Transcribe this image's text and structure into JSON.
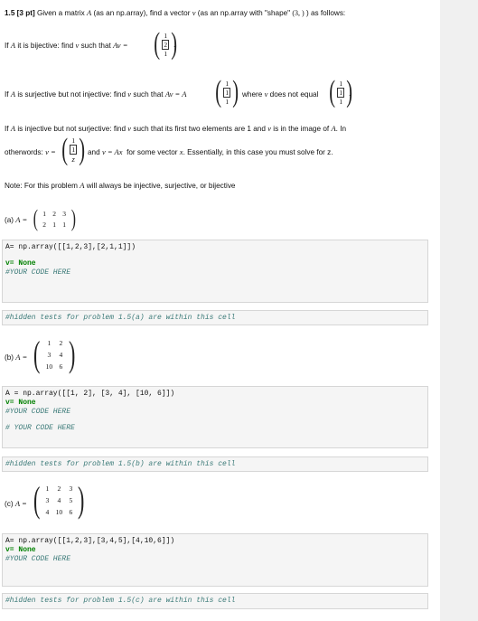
{
  "intro": {
    "label": "1.5 [3 pt]",
    "text_a": "Given a matrix",
    "text_b": "(as an np.array), find a vector",
    "text_c": "(as an np.array with \"shape\"",
    "shape": "(3, )",
    "text_d": ") as follows:"
  },
  "symbols": {
    "A": "A",
    "v": "v",
    "x": "x",
    "z": "z",
    "eq": "="
  },
  "case1": {
    "text_a": "If",
    "text_b": "it is bijective: find",
    "text_c": "such that",
    "expr": "Av =",
    "vec": [
      "1",
      "2",
      "1"
    ],
    "tail": "."
  },
  "case2": {
    "text_a": "If",
    "text_b": "is surjective but not injective: find",
    "text_c": "such that",
    "expr": "Av = A",
    "vec": [
      "1",
      "1",
      "1"
    ],
    "text_d": "where",
    "text_e": "does not equal",
    "vec2": [
      "1",
      "1",
      "1"
    ],
    "tail": "."
  },
  "case3": {
    "line1_a": "If",
    "line1_b": "is injective but not surjective: find",
    "line1_c": "such that its first two elements are 1 and",
    "line1_d": "is in the image of",
    "line1_e": ". In",
    "line2_a": "otherwords:",
    "line2_expr": "v =",
    "vec": [
      "1",
      "1",
      "z"
    ],
    "line2_b": "and",
    "line2_expr2": "v = Ax",
    "line2_c": "for some vector",
    "line2_d": ". Essentially, in this case you must solve for z."
  },
  "note": {
    "text_a": "Note: For this problem",
    "text_b": "will always be injective, surjective, or bijective"
  },
  "part_a": {
    "label": "(a)",
    "expr": "A =",
    "matrix": [
      [
        "1",
        "2",
        "3"
      ],
      [
        "2",
        "1",
        "1"
      ]
    ],
    "code": {
      "line1": "A= np.array([[1,2,3],[2,1,1]])",
      "line2_kw": "v= None",
      "line3": "#YOUR CODE HERE"
    },
    "hidden": "#hidden tests for problem 1.5(a) are within this cell"
  },
  "part_b": {
    "label": "(b)",
    "expr": "A =",
    "matrix": [
      [
        "1",
        "2"
      ],
      [
        "3",
        "4"
      ],
      [
        "10",
        "6"
      ]
    ],
    "code": {
      "line1": "A = np.array([[1, 2], [3, 4], [10, 6]])",
      "line2_kw": "v= None",
      "line3": "#YOUR CODE HERE",
      "line4": "# YOUR CODE HERE"
    },
    "hidden": "#hidden tests for problem 1.5(b) are within this cell"
  },
  "part_c": {
    "label": "(c)",
    "expr": "A =",
    "matrix": [
      [
        "1",
        "2",
        "3"
      ],
      [
        "3",
        "4",
        "5"
      ],
      [
        "4",
        "10",
        "6"
      ]
    ],
    "code": {
      "line1": "A= np.array([[1,2,3],[3,4,5],[4,10,6]])",
      "line2_kw": "v= None",
      "line3": "#YOUR CODE HERE"
    },
    "hidden": "#hidden tests for problem 1.5(c) are within this cell"
  }
}
